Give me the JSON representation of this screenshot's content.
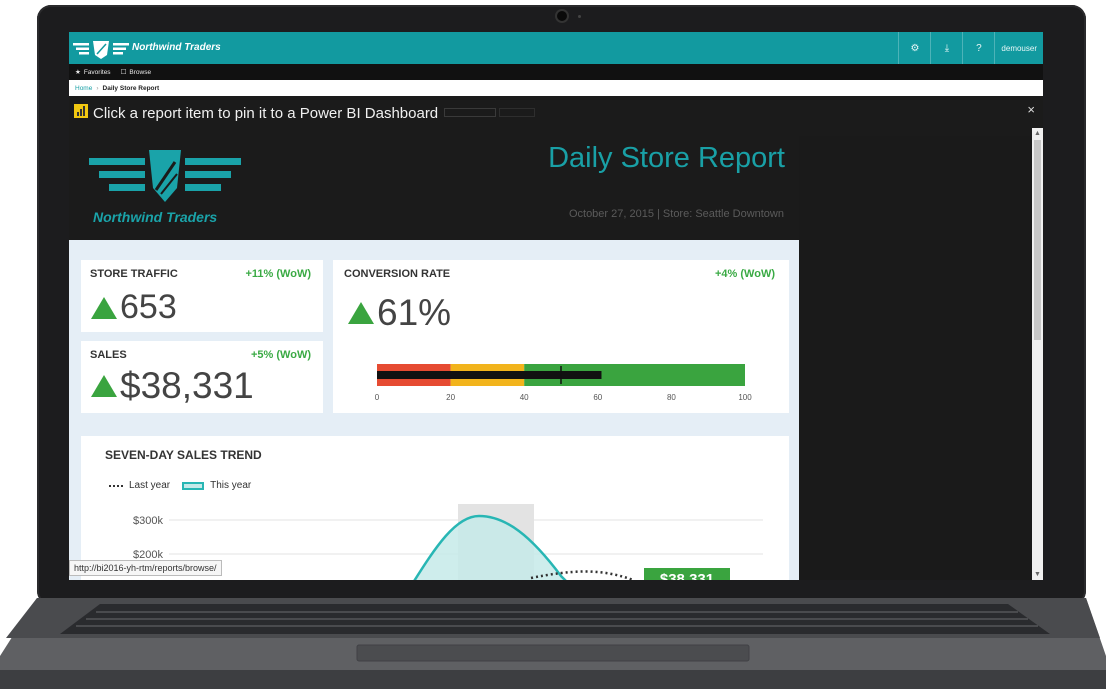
{
  "app": {
    "brand": "Northwind Traders",
    "user": "demouser"
  },
  "favbar": {
    "favorites_label": "Favorites",
    "browse_label": "Browse"
  },
  "breadcrumb": {
    "home": "Home",
    "separator": "›",
    "current": "Daily Store Report"
  },
  "pin_banner": {
    "text": "Click a report item to pin it to a Power BI Dashboard",
    "close": "×"
  },
  "report": {
    "brand": "Northwind Traders",
    "title": "Daily Store Report",
    "subtitle": "October 27, 2015 | Store: Seattle Downtown"
  },
  "kpis": {
    "store_traffic": {
      "label": "STORE TRAFFIC",
      "delta": "+11% (WoW)",
      "value": "653"
    },
    "sales": {
      "label": "SALES",
      "delta": "+5% (WoW)",
      "value": "$38,331"
    },
    "conversion": {
      "label": "CONVERSION RATE",
      "delta": "+4% (WoW)",
      "value": "61%"
    }
  },
  "gauge": {
    "bands": [
      {
        "from": 0,
        "to": 20,
        "color": "#e64b32"
      },
      {
        "from": 20,
        "to": 40,
        "color": "#f2b41c"
      },
      {
        "from": 40,
        "to": 100,
        "color": "#3aa43f"
      }
    ],
    "value": 61,
    "target": 50,
    "ticks": [
      "0",
      "20",
      "40",
      "60",
      "80",
      "100"
    ]
  },
  "trend": {
    "title": "SEVEN-DAY SALES TREND",
    "legend_last_year": "Last year",
    "legend_this_year": "This year",
    "y_ticks": [
      "$300k",
      "$200k"
    ],
    "callout": "$38,331"
  },
  "status_url": "http://bi2016-yh-rtm/reports/browse/",
  "colors": {
    "accent": "#129aa0",
    "positive": "#3aa43f"
  }
}
